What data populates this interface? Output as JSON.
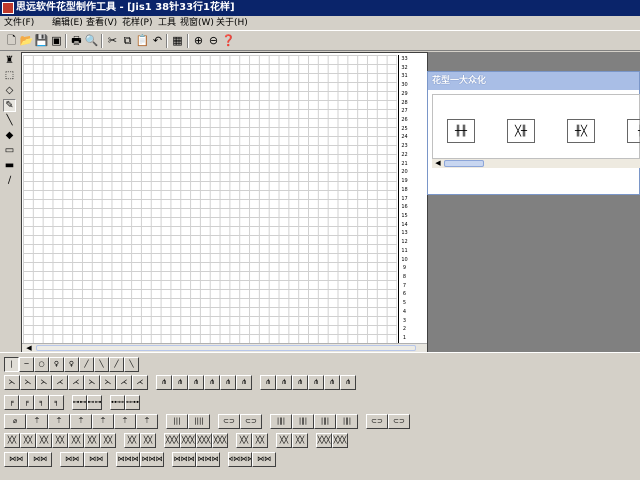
{
  "window": {
    "title": "思远软件花型制作工具 - [Jis1 38针33行1花样]"
  },
  "menu": [
    "文件(F)",
    "编辑(E)",
    "查看(V)",
    "花样(P)",
    "工具",
    "视窗(W)",
    "关于(H)"
  ],
  "toolbar": [
    {
      "name": "new-icon",
      "glyph": "🗋"
    },
    {
      "name": "open-icon",
      "glyph": "📂"
    },
    {
      "name": "save-icon",
      "glyph": "💾"
    },
    {
      "name": "saveall-icon",
      "glyph": "▣"
    },
    {
      "name": "print-icon",
      "glyph": "🖶"
    },
    {
      "name": "preview-icon",
      "glyph": "🔍"
    },
    {
      "name": "cut-icon",
      "glyph": "✂"
    },
    {
      "name": "copy-icon",
      "glyph": "⧉"
    },
    {
      "name": "paste-icon",
      "glyph": "📋"
    },
    {
      "name": "undo-icon",
      "glyph": "↶"
    },
    {
      "name": "grid-icon",
      "glyph": "▦"
    },
    {
      "name": "zoom-in-icon",
      "glyph": "⊕"
    },
    {
      "name": "zoom-out-icon",
      "glyph": "⊖"
    },
    {
      "name": "help-icon",
      "glyph": "❓"
    }
  ],
  "left_tools": [
    {
      "name": "fill-bucket-icon",
      "glyph": "♜"
    },
    {
      "name": "select-rect-icon",
      "glyph": "⬚"
    },
    {
      "name": "eraser-icon",
      "glyph": "◇"
    },
    {
      "name": "pencil-icon",
      "glyph": "✎"
    },
    {
      "name": "line-icon",
      "glyph": "╲"
    },
    {
      "name": "paint-icon",
      "glyph": "◆"
    },
    {
      "name": "rect-outline-icon",
      "glyph": "▭"
    },
    {
      "name": "rect-fill-icon",
      "glyph": "▬"
    },
    {
      "name": "brush-icon",
      "glyph": "∕"
    }
  ],
  "row_numbers": [
    "33",
    "32",
    "31",
    "30",
    "29",
    "28",
    "27",
    "26",
    "25",
    "24",
    "23",
    "22",
    "21",
    "20",
    "19",
    "18",
    "17",
    "16",
    "15",
    "14",
    "13",
    "12",
    "11",
    "10",
    "9",
    "8",
    "7",
    "6",
    "5",
    "4",
    "3",
    "2",
    "1"
  ],
  "palette": {
    "title": "花型一大众化",
    "items": [
      "╫╫",
      "╳╫",
      "╫╳",
      "╫"
    ]
  },
  "stitch_rows": [
    [
      [
        "|",
        "─",
        "○",
        "♀",
        "♀",
        "╱",
        "╲",
        "╱",
        "╲"
      ]
    ],
    [
      [
        "⋋",
        "⋋",
        "⋋",
        "⋌",
        "⋌",
        "⋋",
        "⋋",
        "⋌",
        "⋌"
      ],
      [
        "⋔",
        "⋔",
        "⋔",
        "⋔",
        "⋔",
        "⋔"
      ],
      [
        "⋔",
        "⋔",
        "⋔",
        "⋔",
        "⋔",
        "⋔"
      ]
    ],
    [
      [
        "╒",
        "╒",
        "╕",
        "╕"
      ],
      [
        "⊶⊷",
        "⊷⊶"
      ],
      [
        "⊶⊷⊶",
        "⊷⊶⊷"
      ]
    ],
    [
      [
        "⌀",
        "⍑",
        "⍑",
        "⍑",
        "⍑",
        "⍑",
        "⍑"
      ],
      [
        "|||",
        "||||"
      ],
      [
        "⊂⊃",
        "⊂⊃"
      ],
      [
        "|‖|",
        "|‖|",
        "|‖|",
        "|‖|"
      ],
      [
        "⊂⊃",
        "⊂⊃"
      ]
    ],
    [
      [
        "╳╳",
        "╳╳",
        "╳╳",
        "╳╳",
        "╳╳",
        "╳╳",
        "╳╳"
      ],
      [
        "╳╳",
        "╳╳"
      ],
      [
        "╳╳╳",
        "╳╳╳",
        "╳╳╳",
        "╳╳╳"
      ],
      [
        "╳╳",
        "╳╳"
      ],
      [
        "╳╳",
        "╳╳"
      ],
      [
        "╳╳╳",
        "╳╳╳"
      ]
    ],
    [
      [
        "⋈⋈",
        "⋈⋈"
      ],
      [
        "⋈⋈",
        "⋈⋈"
      ],
      [
        "⋈⋈⋈",
        "⋈⋈⋈"
      ],
      [
        "⋈⋈⋈",
        "⋈⋈⋈"
      ],
      [
        "⋈⋈⋈⋈",
        "⋈⋈"
      ]
    ]
  ],
  "colors": {
    "title_bg": "#0a246a",
    "face": "#d4d0c8",
    "palette_title": "#a9bee6"
  }
}
